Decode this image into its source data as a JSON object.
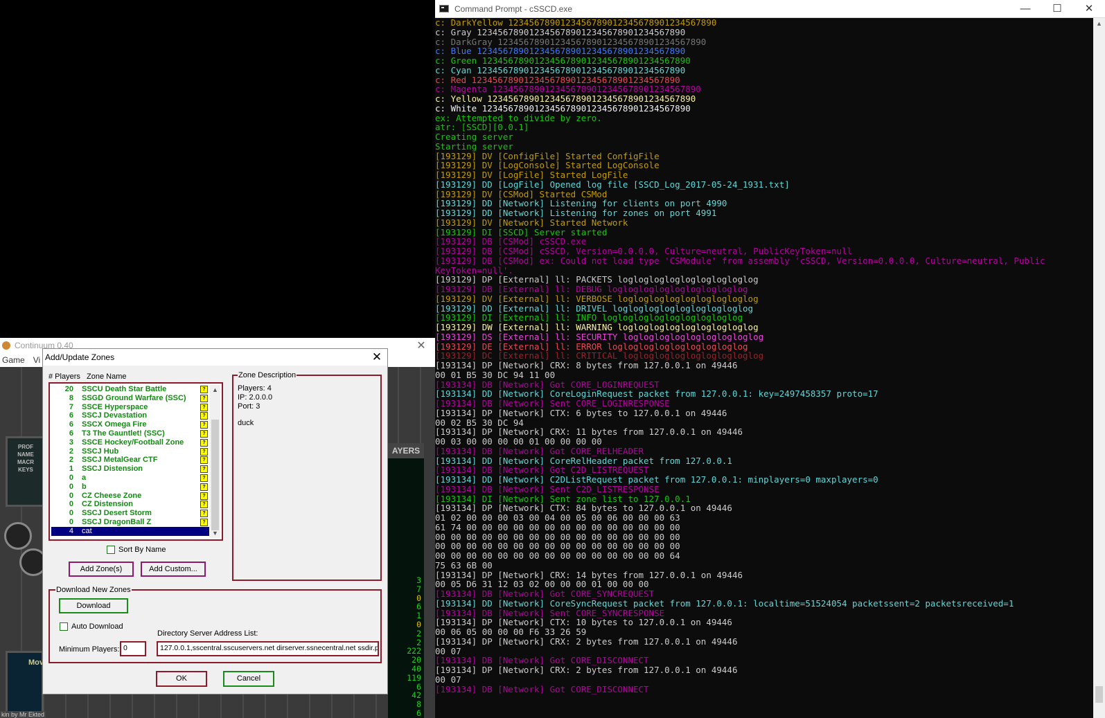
{
  "console_window": {
    "title": "Command Prompt - cSSCD.exe",
    "controls": [
      "—",
      "☐",
      "✕"
    ],
    "lines": [
      {
        "t": "c: DarkYellow 1234567890123456789012345678901234567890",
        "c": "#c19c00"
      },
      {
        "t": "c: Gray 1234567890123456789012345678901234567890",
        "c": "#cccccc"
      },
      {
        "t": "c: DarkGray 1234567890123456789012345678901234567890",
        "c": "#767676"
      },
      {
        "t": "c: Blue 1234567890123456789012345678901234567890",
        "c": "#3b78ff"
      },
      {
        "t": "c: Green 1234567890123456789012345678901234567890",
        "c": "#16c60c"
      },
      {
        "t": "c: Cyan 1234567890123456789012345678901234567890",
        "c": "#61d6d6"
      },
      {
        "t": "c: Red 1234567890123456789012345678901234567890",
        "c": "#e74856"
      },
      {
        "t": "c: Magenta 1234567890123456789012345678901234567890",
        "c": "#b4009e"
      },
      {
        "t": "c: Yellow 1234567890123456789012345678901234567890",
        "c": "#f9f1a5"
      },
      {
        "t": "c: White 1234567890123456789012345678901234567890",
        "c": "#f2f2f2"
      },
      {
        "t": "ex: Attempted to divide by zero.",
        "c": "#16c60c"
      },
      {
        "t": "atr: [SSCD][0.0.1]",
        "c": "#16c60c"
      },
      {
        "t": "Creating server",
        "c": "#16c60c"
      },
      {
        "t": "Starting server",
        "c": "#16c60c"
      },
      {
        "t": "[193129] DV [ConfigFile] Started ConfigFile",
        "c": "#c19c00"
      },
      {
        "t": "[193129] DV [LogConsole] Started LogConsole",
        "c": "#c19c00"
      },
      {
        "t": "[193129] DV [LogFile] Started LogFile",
        "c": "#c19c00"
      },
      {
        "t": "[193129] DD [LogFile] Opened log file [SSCD_Log_2017-05-24_1931.txt]",
        "c": "#61d6d6"
      },
      {
        "t": "[193129] DV [CSMod] Started CSMod",
        "c": "#c19c00"
      },
      {
        "t": "[193129] DD [Network] Listening for clients on port 4990",
        "c": "#61d6d6"
      },
      {
        "t": "[193129] DD [Network] Listening for zones on port 4991",
        "c": "#61d6d6"
      },
      {
        "t": "[193129] DV [Network] Started Network",
        "c": "#c19c00"
      },
      {
        "t": "[193129] DI [SSCD] Server started",
        "c": "#16c60c"
      },
      {
        "t": "[193129] DB [CSMod] cSSCD.exe",
        "c": "#b4009e"
      },
      {
        "t": "[193129] DB [CSMod] cSSCD, Version=0.0.0.0, Culture=neutral, PublicKeyToken=null",
        "c": "#b4009e"
      },
      {
        "t": "[193129] DB [CSMod] ex: Could not load type 'CSModule' from assembly 'cSSCD, Version=0.0.0.0, Culture=neutral, Public",
        "c": "#b4009e"
      },
      {
        "t": "KeyToken=null'.",
        "c": "#b4009e"
      },
      {
        "t": "[193129] DP [External] ll: PACKETS logloglogloglogloglogloglog",
        "c": "#cccccc"
      },
      {
        "t": "[193129] DB [External] ll: DEBUG logloglogloglogloglogloglog",
        "c": "#b4009e"
      },
      {
        "t": "[193129] DV [External] ll: VERBOSE logloglogloglogloglogloglog",
        "c": "#c19c00"
      },
      {
        "t": "[193129] DD [External] ll: DRIVEL logloglogloglogloglogloglog",
        "c": "#61d6d6"
      },
      {
        "t": "[193129] DI [External] ll: INFO logloglogloglogloglogloglog",
        "c": "#16c60c"
      },
      {
        "t": "[193129] DW [External] ll: WARNING logloglogloglogloglogloglog",
        "c": "#f9f1a5"
      },
      {
        "t": "[193129] DS [External] ll: SECURITY logloglogloglogloglogloglog",
        "c": "#e845d8"
      },
      {
        "t": "[193129] DE [External] ll: ERROR logloglogloglogloglogloglog",
        "c": "#e74856"
      },
      {
        "t": "[193129] DC [External] ll: CRITICAL logloglogloglogloglogloglog",
        "c": "#9e1f2a"
      },
      {
        "t": "[193134] DP [Network] CRX: 8 bytes from 127.0.0.1 on 49446",
        "c": "#cccccc"
      },
      {
        "t": "00 01 B5 30 DC 94 11 00",
        "c": "#cccccc"
      },
      {
        "t": "[193134] DB [Network] Got CORE_LOGINREQUEST",
        "c": "#b4009e"
      },
      {
        "t": "[193134] DD [Network] CoreLoginRequest packet from 127.0.0.1: key=2497458357 proto=17",
        "c": "#61d6d6"
      },
      {
        "t": "[193134] DB [Network] Sent CORE_LOGINRESPONSE",
        "c": "#b4009e"
      },
      {
        "t": "[193134] DP [Network] CTX: 6 bytes to 127.0.0.1 on 49446",
        "c": "#cccccc"
      },
      {
        "t": "00 02 B5 30 DC 94",
        "c": "#cccccc"
      },
      {
        "t": "[193134] DP [Network] CRX: 11 bytes from 127.0.0.1 on 49446",
        "c": "#cccccc"
      },
      {
        "t": "00 03 00 00 00 00 01 00 00 00 00",
        "c": "#cccccc"
      },
      {
        "t": "[193134] DB [Network] Got CORE_RELHEADER",
        "c": "#b4009e"
      },
      {
        "t": "[193134] DD [Network] CoreRelHeader packet from 127.0.0.1",
        "c": "#61d6d6"
      },
      {
        "t": "[193134] DB [Network] Got C2D_LISTREQUEST",
        "c": "#b4009e"
      },
      {
        "t": "[193134] DD [Network] C2DListRequest packet from 127.0.0.1: minplayers=0 maxplayers=0",
        "c": "#61d6d6"
      },
      {
        "t": "[193134] DB [Network] Sent C2D_LISTRESPONSE",
        "c": "#b4009e"
      },
      {
        "t": "[193134] DI [Network] Sent zone list to 127.0.0.1",
        "c": "#16c60c"
      },
      {
        "t": "[193134] DP [Network] CTX: 84 bytes to 127.0.0.1 on 49446",
        "c": "#cccccc"
      },
      {
        "t": "01 02 00 00 00 03 00 04 00 05 00 06 00 00 00 63",
        "c": "#cccccc"
      },
      {
        "t": "61 74 00 00 00 00 00 00 00 00 00 00 00 00 00 00",
        "c": "#cccccc"
      },
      {
        "t": "00 00 00 00 00 00 00 00 00 00 00 00 00 00 00 00",
        "c": "#cccccc"
      },
      {
        "t": "00 00 00 00 00 00 00 00 00 00 00 00 00 00 00 00",
        "c": "#cccccc"
      },
      {
        "t": "00 00 00 00 00 00 00 00 00 00 00 00 00 00 00 64",
        "c": "#cccccc"
      },
      {
        "t": "75 63 6B 00",
        "c": "#cccccc"
      },
      {
        "t": "[193134] DP [Network] CRX: 14 bytes from 127.0.0.1 on 49446",
        "c": "#cccccc"
      },
      {
        "t": "00 05 D6 31 12 03 02 00 00 00 01 00 00 00",
        "c": "#cccccc"
      },
      {
        "t": "[193134] DB [Network] Got CORE_SYNCREQUEST",
        "c": "#b4009e"
      },
      {
        "t": "[193134] DD [Network] CoreSyncRequest packet from 127.0.0.1: localtime=51524054 packetssent=2 packetsreceived=1",
        "c": "#61d6d6"
      },
      {
        "t": "[193134] DB [Network] Sent CORE_SYNCRESPONSE",
        "c": "#b4009e"
      },
      {
        "t": "[193134] DP [Network] CTX: 10 bytes to 127.0.0.1 on 49446",
        "c": "#cccccc"
      },
      {
        "t": "00 06 05 00 00 00 F6 33 26 59",
        "c": "#cccccc"
      },
      {
        "t": "[193134] DP [Network] CRX: 2 bytes from 127.0.0.1 on 49446",
        "c": "#cccccc"
      },
      {
        "t": "00 07",
        "c": "#cccccc"
      },
      {
        "t": "[193134] DB [Network] Got CORE_DISCONNECT",
        "c": "#b4009e"
      },
      {
        "t": "[193134] DP [Network] CRX: 2 bytes from 127.0.0.1 on 49446",
        "c": "#cccccc"
      },
      {
        "t": "00 07",
        "c": "#cccccc"
      },
      {
        "t": "[193134] DB [Network] Got CORE_DISCONNECT",
        "c": "#b4009e"
      }
    ]
  },
  "continuum_window": {
    "title": "Continuum 0.40",
    "menu": [
      "Game",
      "Vi"
    ],
    "left_panel": [
      "PROF",
      "NAME",
      "MACR",
      "KEYS"
    ],
    "players_label": "AYERS",
    "player_counts": [
      "3",
      "7",
      "0",
      "6",
      "1",
      "0",
      "2",
      "2",
      "222",
      "20",
      "40",
      "119",
      "6",
      "42",
      "8",
      "6"
    ],
    "player_count_colors": [
      "#1fd21f",
      "#1fd21f",
      "#e0c000",
      "#1fd21f",
      "#1fd21f",
      "#e0c000",
      "#1fd21f",
      "#1fd21f",
      "#1fd21f",
      "#1fd21f",
      "#1fd21f",
      "#1fd21f",
      "#1fd21f",
      "#1fd21f",
      "#1fd21f",
      "#1fd21f"
    ],
    "mov_label": "Mov",
    "credits": "kin by Mr Ekted"
  },
  "dialog": {
    "title": "Add/Update Zones",
    "list_header": "# Players   Zone Name",
    "zones": [
      {
        "count": "20",
        "name": "SSCU Death Star Battle"
      },
      {
        "count": "8",
        "name": "SSGD Ground Warfare (SSC)"
      },
      {
        "count": "7",
        "name": "SSCE Hyperspace"
      },
      {
        "count": "6",
        "name": "SSCJ Devastation"
      },
      {
        "count": "6",
        "name": "SSCX Omega Fire"
      },
      {
        "count": "6",
        "name": "T3 The Gauntlet! (SSC)"
      },
      {
        "count": "3",
        "name": "SSCE Hockey/Football Zone"
      },
      {
        "count": "2",
        "name": "SSCJ Hub"
      },
      {
        "count": "2",
        "name": "SSCJ MetalGear CTF"
      },
      {
        "count": "1",
        "name": "SSCJ Distension"
      },
      {
        "count": "0",
        "name": "a"
      },
      {
        "count": "0",
        "name": "b"
      },
      {
        "count": "0",
        "name": "CZ Cheese Zone"
      },
      {
        "count": "0",
        "name": "CZ Distension"
      },
      {
        "count": "0",
        "name": "SSCJ Desert Storm"
      },
      {
        "count": "0",
        "name": "SSCJ DragonBall Z"
      },
      {
        "count": "4",
        "name": "cat",
        "selected": true
      }
    ],
    "sort_by_name": "Sort By Name",
    "add_zones": "Add Zone(s)",
    "add_custom": "Add Custom...",
    "zone_description": {
      "legend": "Zone Description",
      "players": "Players: 4",
      "ip": "IP: 2.0.0.0",
      "port": "Port: 3",
      "desc": "duck"
    },
    "download_group": {
      "legend": "Download New Zones",
      "download": "Download",
      "auto_download": "Auto Download",
      "dir_label": "Directory Server Address List:",
      "dir_value": "127.0.0.1,sscentral.sscuservers.net dirserver.ssnecentral.net ssdir.p",
      "min_players_label": "Minimum Players:",
      "min_players_value": "0"
    },
    "ok": "OK",
    "cancel": "Cancel"
  }
}
